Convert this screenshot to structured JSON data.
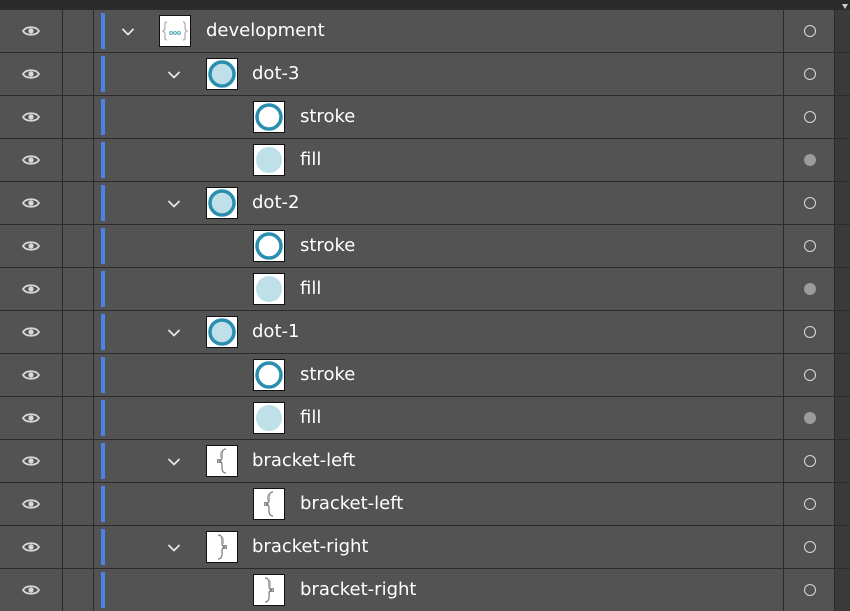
{
  "layers": [
    {
      "label": "development",
      "level": 0,
      "expanded": true,
      "thumbnail": "development-group-icon",
      "target_filled": false
    },
    {
      "label": "dot-3",
      "level": 1,
      "expanded": true,
      "thumbnail": "dot-group-icon",
      "target_filled": false
    },
    {
      "label": "stroke",
      "level": 2,
      "expanded": null,
      "thumbnail": "stroke-ring-icon",
      "target_filled": false
    },
    {
      "label": "fill",
      "level": 2,
      "expanded": null,
      "thumbnail": "fill-circle-icon",
      "target_filled": true
    },
    {
      "label": "dot-2",
      "level": 1,
      "expanded": true,
      "thumbnail": "dot-group-icon",
      "target_filled": false
    },
    {
      "label": "stroke",
      "level": 2,
      "expanded": null,
      "thumbnail": "stroke-ring-icon",
      "target_filled": false
    },
    {
      "label": "fill",
      "level": 2,
      "expanded": null,
      "thumbnail": "fill-circle-icon",
      "target_filled": true
    },
    {
      "label": "dot-1",
      "level": 1,
      "expanded": true,
      "thumbnail": "dot-group-icon",
      "target_filled": false
    },
    {
      "label": "stroke",
      "level": 2,
      "expanded": null,
      "thumbnail": "stroke-ring-icon",
      "target_filled": false
    },
    {
      "label": "fill",
      "level": 2,
      "expanded": null,
      "thumbnail": "fill-circle-icon",
      "target_filled": true
    },
    {
      "label": "bracket-left",
      "level": 1,
      "expanded": true,
      "thumbnail": "bracket-left-icon",
      "target_filled": false
    },
    {
      "label": "bracket-left",
      "level": 2,
      "expanded": null,
      "thumbnail": "bracket-left-icon",
      "target_filled": false
    },
    {
      "label": "bracket-right",
      "level": 1,
      "expanded": true,
      "thumbnail": "bracket-right-icon",
      "target_filled": false
    },
    {
      "label": "bracket-right",
      "level": 2,
      "expanded": null,
      "thumbnail": "bracket-right-icon",
      "target_filled": false
    }
  ],
  "colors": {
    "row_bg": "#535353",
    "layer_color_bar": "#4a82ea",
    "dot_stroke": "#2a8fae",
    "dot_fill": "#bfe0e8"
  }
}
